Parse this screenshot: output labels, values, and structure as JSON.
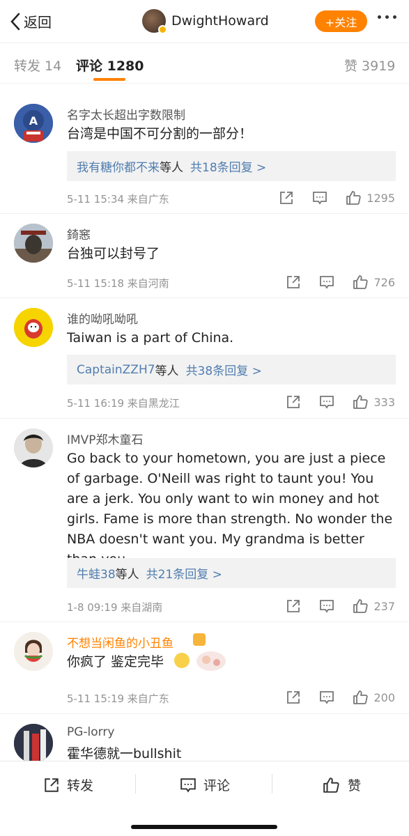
{
  "header": {
    "back_label": "返回",
    "username": "DwightHoward",
    "follow_label": "+关注"
  },
  "tabs": {
    "repost": "转发 14",
    "comments": "评论 1280",
    "likes": "赞 3919"
  },
  "comments": [
    {
      "user": "名字太长超出字数限制",
      "text": "台湾是中国不可分割的一部分！",
      "reply_users": "我有糖你都不来",
      "reply_suffix": "等人",
      "reply_count": "共18条回复 >",
      "meta": "5-11 15:34  来自广东",
      "likes": "1295"
    },
    {
      "user": "錡窸",
      "text": "台独可以封号了",
      "meta": "5-11 15:18  来自河南",
      "likes": "726"
    },
    {
      "user": "谁的呦吼呦吼",
      "text": "Taiwan is a part of China.",
      "reply_users": "CaptainZZH7",
      "reply_suffix": "等人",
      "reply_count": "共38条回复 >",
      "meta": "5-11 16:19  来自黑龙江",
      "likes": "333"
    },
    {
      "user": "IMVP郑木童石",
      "text": "Go back to your hometown, you are just a piece of garbage. O'Neill was right to taunt you! You are a jerk. You only want to win money and hot girls. Fame is more than strength. No wonder the NBA doesn't want you. My grandma is better than you.",
      "reply_users": "牛蛙38",
      "reply_suffix": "等人",
      "reply_count": "共21条回复 >",
      "meta": "1-8 09:19  来自湖南",
      "likes": "237"
    },
    {
      "user": "不想当闲鱼的小丑鱼",
      "text": "你疯了 鉴定完毕",
      "meta": "5-11 15:19  来自广东",
      "likes": "200"
    },
    {
      "user": "PG-lorry",
      "text": "霍华德就一bullshit"
    }
  ],
  "bottom_bar": {
    "repost": "转发",
    "comment": "评论",
    "like": "赞"
  },
  "colors": {
    "accent": "#ff8200",
    "link": "#507daf",
    "muted": "#939393"
  }
}
